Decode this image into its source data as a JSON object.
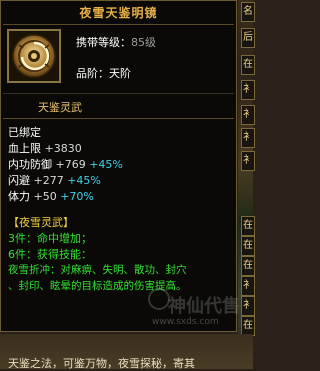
{
  "tooltip": {
    "title": "夜雪天鉴明镜",
    "level_label": "携带等级：",
    "level_value": "85级",
    "grade_label": "品阶：",
    "grade_value": "天阶",
    "item_name": "天鉴灵武",
    "bound": "已绑定",
    "stats": [
      {
        "name": "血上限",
        "value": "+3830",
        "bonus": ""
      },
      {
        "name": "内功防御",
        "value": "+769",
        "bonus": "+45%"
      },
      {
        "name": "闪避",
        "value": "+277",
        "bonus": "+45%"
      },
      {
        "name": "体力",
        "value": "+50",
        "bonus": "+70%"
      }
    ],
    "set_name": "【夜雪灵武】",
    "set_bonus_3": "3件：命中增加；",
    "set_bonus_6": "6件：获得技能：",
    "skill_line1": "夜雪折冲：对麻痹、失明、散功、封穴",
    "skill_line2": "、封印、眩晕的目标造成的伤害提高。"
  },
  "watermark": {
    "text": "神仙代售",
    "url": "www.sxds.com"
  },
  "background": {
    "right_tabs": [
      "名",
      "后",
      "在",
      "衤",
      "衤",
      "衤",
      "衤",
      "在",
      "在",
      "在",
      "衤",
      "衤",
      "在"
    ],
    "bottom_text": "天鉴之法，可鉴万物，夜雪探秘，寄其"
  },
  "colors": {
    "title": "#e8b04a",
    "cyan_bonus": "#3fd0e8",
    "set_yellow": "#f0d040",
    "set_green": "#32e032"
  }
}
